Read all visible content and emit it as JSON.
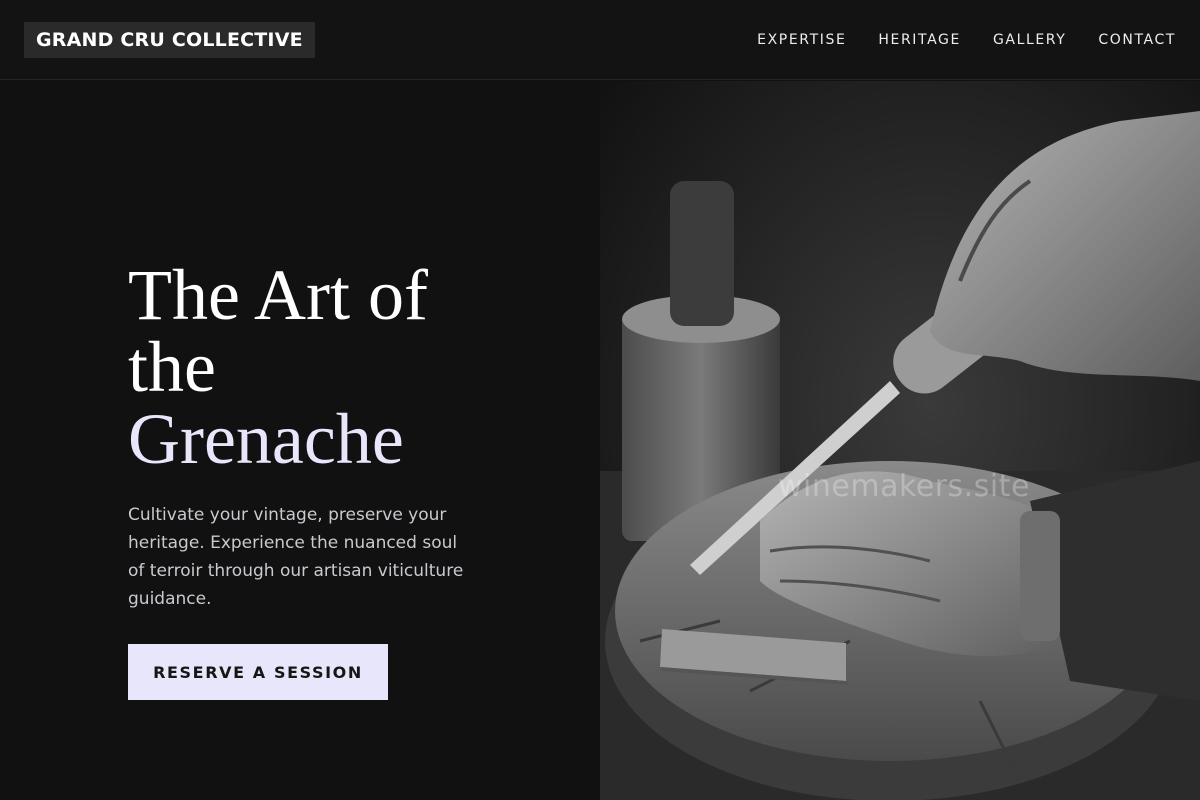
{
  "header": {
    "logo": "GRAND CRU COLLECTIVE",
    "nav": [
      "EXPERTISE",
      "HERITAGE",
      "GALLERY",
      "CONTACT"
    ]
  },
  "hero": {
    "title_line1": "The Art of",
    "title_line2": "the",
    "title_accent": "Grenache",
    "subtitle": "Cultivate your vintage, preserve your heritage. Experience the nuanced soul of terroir through our artisan viticulture guidance.",
    "cta_label": "RESERVE A SESSION"
  },
  "image": {
    "watermark": "winemakers.site"
  },
  "colors": {
    "background": "#111112",
    "accent": "#e8e6fb",
    "header_bg": "#131313"
  }
}
